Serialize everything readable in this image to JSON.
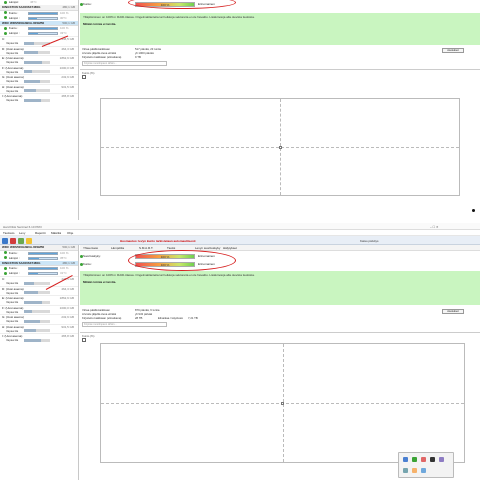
{
  "shot1": {
    "sidebar": {
      "top_rows": [
        {
          "label": "Lämpö:",
          "value": "46°C"
        }
      ],
      "drives": [
        {
          "name": "KINGSTON SA400S37480G",
          "size": "480,1 GB",
          "rows": [
            {
              "label": "Kunto :",
              "pct": 100,
              "value": "100 %"
            },
            {
              "label": "Lämpö :",
              "pct": 30,
              "value": "30°C"
            }
          ],
          "selected": false
        },
        {
          "name": "WDC WDS500G2B0A-00SM50",
          "size": "500,1 GB",
          "rows": [
            {
              "label": "Kunto :",
              "pct": 100,
              "value": "100 %"
            },
            {
              "label": "Lämpö :",
              "pct": 33,
              "value": "33°C"
            }
          ],
          "selected": true
        }
      ],
      "volumes": [
        {
          "name": "C:",
          "size": "446,5 GB",
          "free_pct": 40,
          "free_label": "Vapaa tila"
        },
        {
          "name": "D: (Uusi asema)",
          "size": "464,3 GB",
          "free_pct": 55,
          "free_label": "Vapaa tila"
        },
        {
          "name": "E: (Uusi asema)",
          "size": "1862,9 GB",
          "free_pct": 70,
          "free_label": "Vapaa tila"
        },
        {
          "name": "F: (Uusi asema)",
          "size": "1000,0 GB",
          "free_pct": 30,
          "free_label": "Vapaa tila"
        },
        {
          "name": "G: (Uusi asema)",
          "size": "232,9 GB",
          "free_pct": 60,
          "free_label": "Vapaa tila"
        },
        {
          "name": "H: (Uusi asema)",
          "size": "931,5 GB",
          "free_pct": 45,
          "free_label": "Vapaa tila"
        },
        {
          "name": "I: (Uusi asema)",
          "size": "465,8 GB",
          "free_pct": 65,
          "free_label": "Vapaa tila"
        }
      ]
    },
    "status": [
      {
        "label": "Kunto:",
        "bar_text": "100 %",
        "status_text": "Erinomainen"
      }
    ],
    "green": {
      "line1": "Ylläpitäminen on 100%:n RAID-tilassa. Ongelmatilanteita tai heikkoja sektoreita ei ole havaittu. Lisää tietoja alla olevista tiedoista.",
      "line2": "Mitään toimia ei tarvita."
    },
    "info": {
      "lines": [
        "Virtaa päällä kaikkiaan",
        "Arvioitu jäljellä oleva elinikä",
        "Kirjoitettu kaikkiaan (elinaikana)"
      ],
      "values": [
        "517 päivää, 23 tuntia",
        "yli 1000 päivää",
        "9 TB"
      ],
      "button": "Asetukset",
      "input_placeholder": "Kirjoita muistiinpano tähän…"
    },
    "chart": {
      "title": "Kunto (%)"
    }
  },
  "shot2": {
    "window_title": "Hard Disk Sentinel 6.10 PRO",
    "menu": [
      "Tiedosto",
      "Levy",
      "Raportti",
      "Määritä",
      "Ohje"
    ],
    "wordbar": [
      "Yhteenveto",
      "Lämpötila",
      "S.M.A.R.T.",
      "Tiedot",
      "Levyn suorituskyky",
      "Hälytykset"
    ],
    "right_tray_text": "Katso päivitys",
    "notice": "Huomautus: levyn kunto tarkistetaan automaattisesti",
    "sidebar": {
      "drives": [
        {
          "name": "WDC WDS500G2B0A-00SM50",
          "size": "500,1 GB",
          "rows": [
            {
              "label": "Kunto :",
              "pct": 100,
              "value": "100 %"
            },
            {
              "label": "Lämpö :",
              "pct": 35,
              "value": "35°C"
            }
          ],
          "selected": false
        },
        {
          "name": "KINGSTON SA400S37480G",
          "size": "480,1 GB",
          "rows": [
            {
              "label": "Kunto :",
              "pct": 100,
              "value": "100 %"
            },
            {
              "label": "Lämpö :",
              "pct": 31,
              "value": "31°C"
            }
          ],
          "selected": true
        }
      ],
      "volumes": [
        {
          "name": "C:",
          "size": "446,5 GB",
          "free_pct": 40,
          "free_label": "Vapaa tila"
        },
        {
          "name": "D: (Uusi asema)",
          "size": "464,3 GB",
          "free_pct": 55,
          "free_label": "Vapaa tila"
        },
        {
          "name": "E: (Uusi asema)",
          "size": "1862,9 GB",
          "free_pct": 70,
          "free_label": "Vapaa tila"
        },
        {
          "name": "F: (Uusi asema)",
          "size": "1000,0 GB",
          "free_pct": 30,
          "free_label": "Vapaa tila"
        },
        {
          "name": "G: (Uusi asema)",
          "size": "232,9 GB",
          "free_pct": 60,
          "free_label": "Vapaa tila"
        },
        {
          "name": "H: (Uusi asema)",
          "size": "931,5 GB",
          "free_pct": 45,
          "free_label": "Vapaa tila"
        },
        {
          "name": "I: (Uusi asema)",
          "size": "465,8 GB",
          "free_pct": 65,
          "free_label": "Vapaa tila"
        }
      ]
    },
    "status": [
      {
        "label": "Suorituskyky:",
        "bar_text": "100 %",
        "status_text": "Erinomainen"
      },
      {
        "label": "Kunto:",
        "bar_text": "100 %",
        "status_text": "Erinomainen"
      }
    ],
    "green": {
      "line1": "Ylläpitäminen on 100%:n RAID-tilassa. Ongelmatilanteita tai heikkoja sektoreita ei ole havaittu. Lisää tietoja alla olevista tiedoista.",
      "line2": "Mitään toimia ei tarvita."
    },
    "info": {
      "lines": [
        "Virtaa päällä kaikkiaan",
        "Arvioitu jäljellä oleva elinikä",
        "Kirjoitettu kaikkiaan (elinaikana)"
      ],
      "values": [
        "879 päivää, 6 tuntia",
        "yli 943 päivää",
        "28 TB"
      ],
      "extra_label": "Elinaikaa / käytössä",
      "extra_value": "7,21 TB",
      "button": "Asetukset",
      "input_placeholder": "Kirjoita muistiinpano tähän…"
    },
    "chart": {
      "title": "Kunto (%)"
    }
  }
}
